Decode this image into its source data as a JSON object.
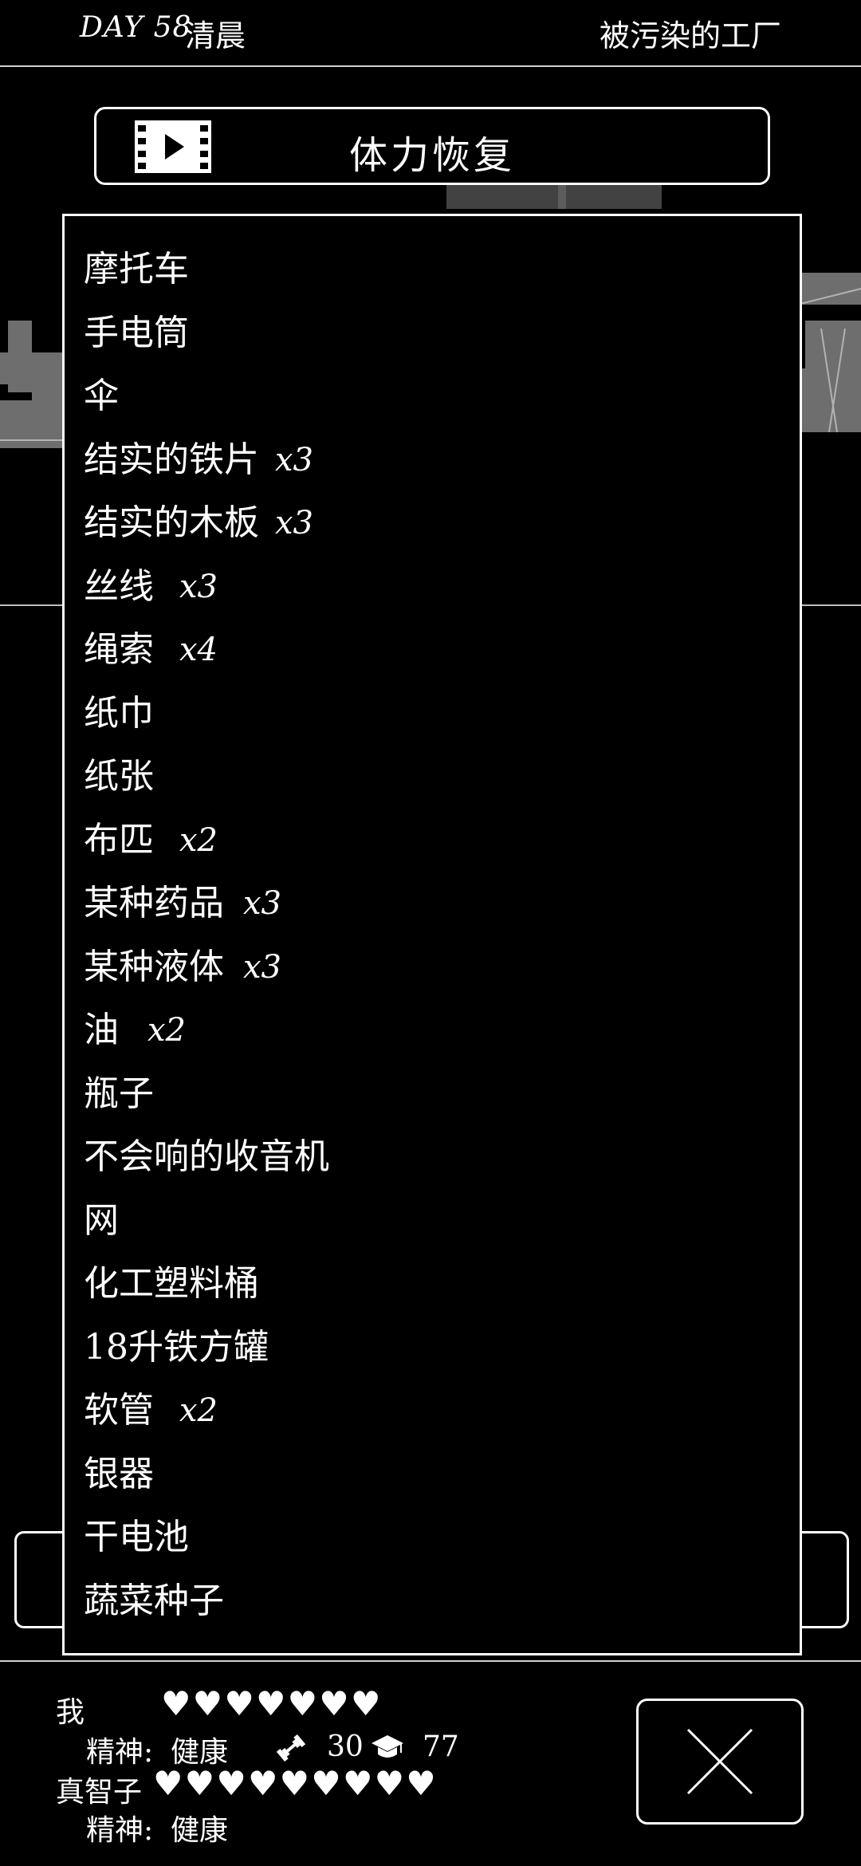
{
  "header": {
    "day": "DAY 58",
    "time_of_day": "清晨",
    "location": "被污染的工厂"
  },
  "recover_button": {
    "label": "体力恢复",
    "icon": "film-icon"
  },
  "inventory": [
    {
      "name": "摩托车",
      "qty": ""
    },
    {
      "name": "手电筒",
      "qty": ""
    },
    {
      "name": "伞",
      "qty": ""
    },
    {
      "name": "结实的铁片",
      "qty": "x3"
    },
    {
      "name": "结实的木板",
      "qty": "x3"
    },
    {
      "name": "丝线",
      "qty": "x3"
    },
    {
      "name": "绳索",
      "qty": "x4"
    },
    {
      "name": "纸巾",
      "qty": ""
    },
    {
      "name": "纸张",
      "qty": ""
    },
    {
      "name": "布匹",
      "qty": "x2"
    },
    {
      "name": "某种药品",
      "qty": "x3"
    },
    {
      "name": "某种液体",
      "qty": "x3"
    },
    {
      "name": "油",
      "qty": "x2"
    },
    {
      "name": "瓶子",
      "qty": ""
    },
    {
      "name": "不会响的收音机",
      "qty": ""
    },
    {
      "name": "网",
      "qty": ""
    },
    {
      "name": "化工塑料桶",
      "qty": ""
    },
    {
      "name": "18升铁方罐",
      "qty": ""
    },
    {
      "name": "软管",
      "qty": "x2"
    },
    {
      "name": "银器",
      "qty": ""
    },
    {
      "name": "干电池",
      "qty": ""
    },
    {
      "name": "蔬菜种子",
      "qty": ""
    }
  ],
  "status": {
    "player": {
      "name": "我",
      "hearts": 7,
      "mental_label": "精神:",
      "mental_value": "健康",
      "strength": "30",
      "intelligence": "77"
    },
    "companion": {
      "name": "真智子",
      "hearts": 9,
      "mental_label": "精神:",
      "mental_value": "健康"
    }
  },
  "close_button": {
    "icon": "close-icon"
  }
}
